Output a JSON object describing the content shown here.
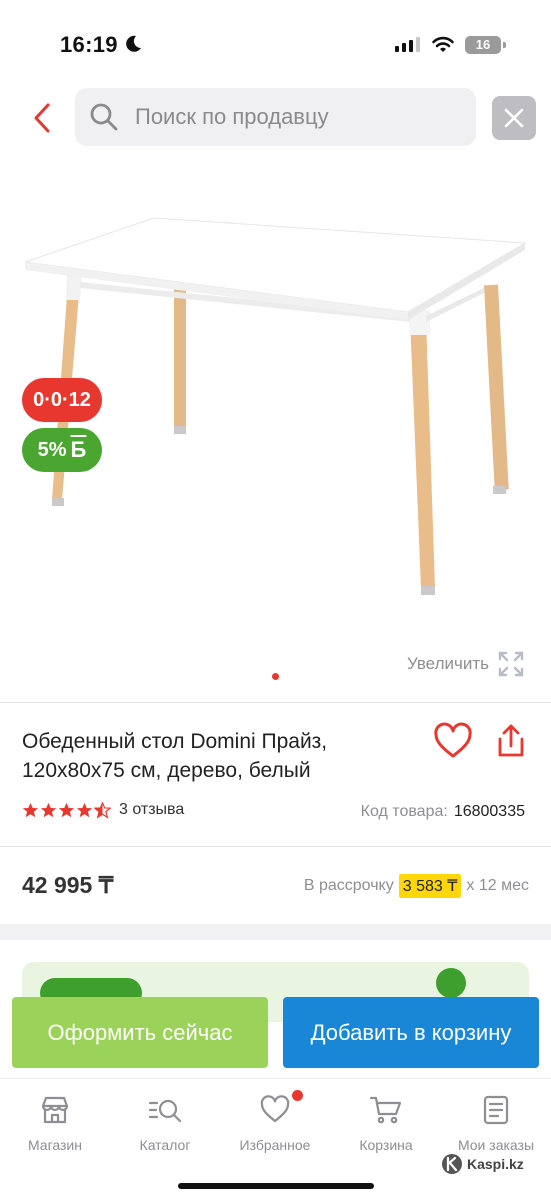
{
  "status_bar": {
    "time": "16:19",
    "battery": "16"
  },
  "header": {
    "search_placeholder": "Поиск по продавцу"
  },
  "badges": {
    "installment": "0·0·12",
    "bonus_percent": "5%",
    "bonus_symbol": "Б"
  },
  "gallery": {
    "zoom_label": "Увеличить",
    "current_slide": 1,
    "total_slides": 1
  },
  "product": {
    "title": "Обеденный стол Domini Прайз, 120x80x75 см, дерево, белый",
    "rating": 4.5,
    "reviews": "3 отзыва",
    "sku_label": "Код товара:",
    "sku": "16800335",
    "price": "42 995 ₸",
    "credit_prefix": "В рассрочку",
    "credit_monthly": "3 583 ₸",
    "credit_suffix": "x 12 мес"
  },
  "actions": {
    "buy_now": "Оформить сейчас",
    "add_to_cart": "Добавить в корзину"
  },
  "tabs": [
    {
      "label": "Магазин",
      "icon": "store-icon"
    },
    {
      "label": "Каталог",
      "icon": "catalog-search-icon"
    },
    {
      "label": "Избранное",
      "icon": "heart-icon",
      "has_notification": true
    },
    {
      "label": "Корзина",
      "icon": "cart-icon"
    },
    {
      "label": "Мои заказы",
      "icon": "orders-icon"
    }
  ],
  "watermark": "Kaspi.kz",
  "colors": {
    "brand_red": "#e8372f",
    "buy_green": "#9bd35a",
    "cart_blue": "#1a86d6",
    "bonus_green": "#4aa631",
    "highlight_yellow": "#ffd70a"
  }
}
